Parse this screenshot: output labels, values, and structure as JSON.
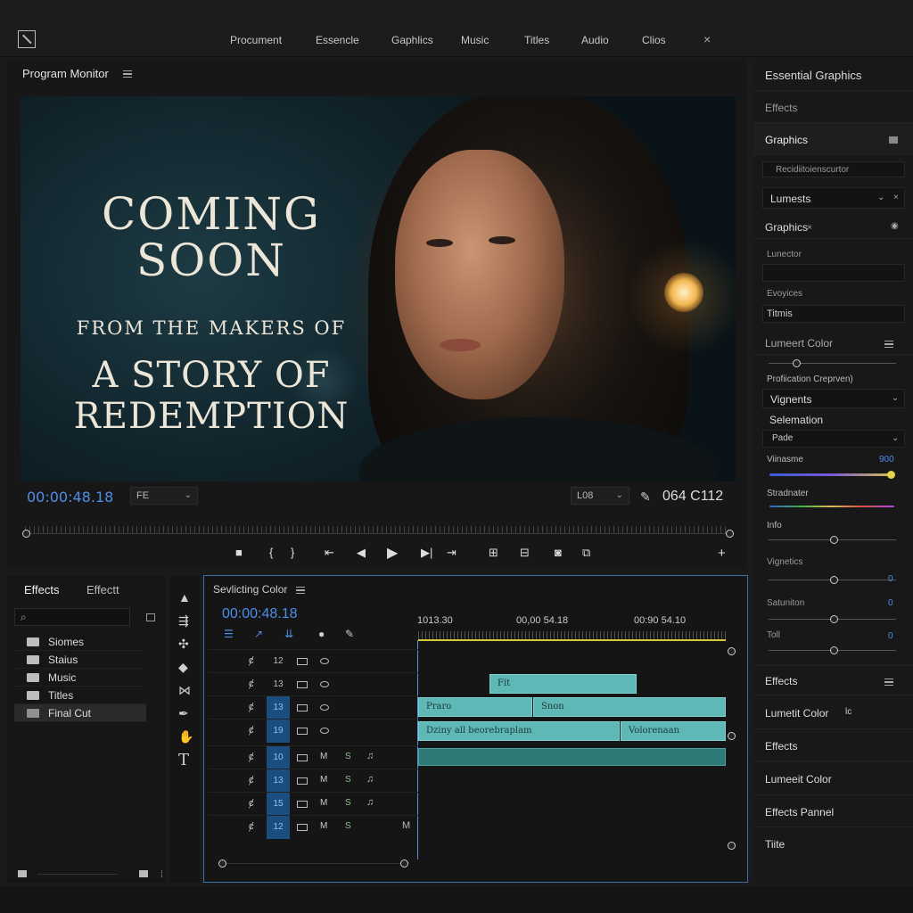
{
  "menu": {
    "items": [
      "Procument",
      "Essencle",
      "Gaphlics",
      "Music",
      "Titles",
      "Audio",
      "Clios"
    ],
    "close": "×"
  },
  "monitor": {
    "title": "Program Monitor",
    "overlay": {
      "line1": "COMING",
      "line2": "SOON",
      "line3": "FROM THE MAKERS OF",
      "line4": "A STORY OF",
      "line5": "REDEMPTION"
    },
    "timecode": "00:00:48.18",
    "fit_value": "FE",
    "quality_value": "L08",
    "timecode_right": "064 C112"
  },
  "effects_panel": {
    "tab1": "Effects",
    "tab2": "Effectt",
    "search_icon": "⌕",
    "items": [
      "Siomes",
      "Staius",
      "Music",
      "Titles",
      "Final Cut"
    ],
    "selected_index": 4
  },
  "timeline": {
    "title": "Sevlicting Color",
    "timecode": "00:00:48.18",
    "ruler": [
      "1013.30",
      "00,00 54.18",
      "00:90 54.10"
    ],
    "tracks": [
      {
        "label": "12",
        "highlight": false
      },
      {
        "label": "13",
        "highlight": false
      },
      {
        "label": "13",
        "highlight": true
      },
      {
        "label": "19",
        "highlight": true
      },
      {
        "label": "10",
        "highlight": true
      },
      {
        "label": "13",
        "highlight": true
      },
      {
        "label": "15",
        "highlight": true
      },
      {
        "label": "12",
        "highlight": true
      }
    ],
    "clips": {
      "c1": "Fit",
      "c2": "Praro",
      "c3": "Snon",
      "c4": "Dziny all beorebraplam",
      "c5": "Volorenaan"
    }
  },
  "right_panel": {
    "essential_graphics": "Essential Graphics",
    "effects1": "Effects",
    "graphics1": "Graphics",
    "field_recording": "Recidiitoienscurtor",
    "lumests": "Lumests",
    "graphics2": "Graphics",
    "lunector": "Lunector",
    "evoyices": "Evoyices",
    "titmis": "Titmis",
    "lumeert_color": "Lumeert Color",
    "proficiation": "Profiication Creprven)",
    "vignents": "Vignents",
    "selemation": "Selemation",
    "pade": "Pade",
    "viinasme": "Viinasme",
    "viinasme_value": "900",
    "stradnater": "Stradnater",
    "info": "Info",
    "vignetics": "Vignetics",
    "vignetics_value": "0",
    "satuniton": "Satuniton",
    "satuniton_value": "0",
    "toll": "Toll",
    "toll_value": "0",
    "effects2": "Effects",
    "lumetit_color": "Lumetit Color",
    "lumetit_suffix": "lc",
    "effects3": "Effects",
    "lumeeit_color": "Lumeeit Color",
    "effects_pannel": "Effects Pannel",
    "tiite": "Tiite"
  }
}
